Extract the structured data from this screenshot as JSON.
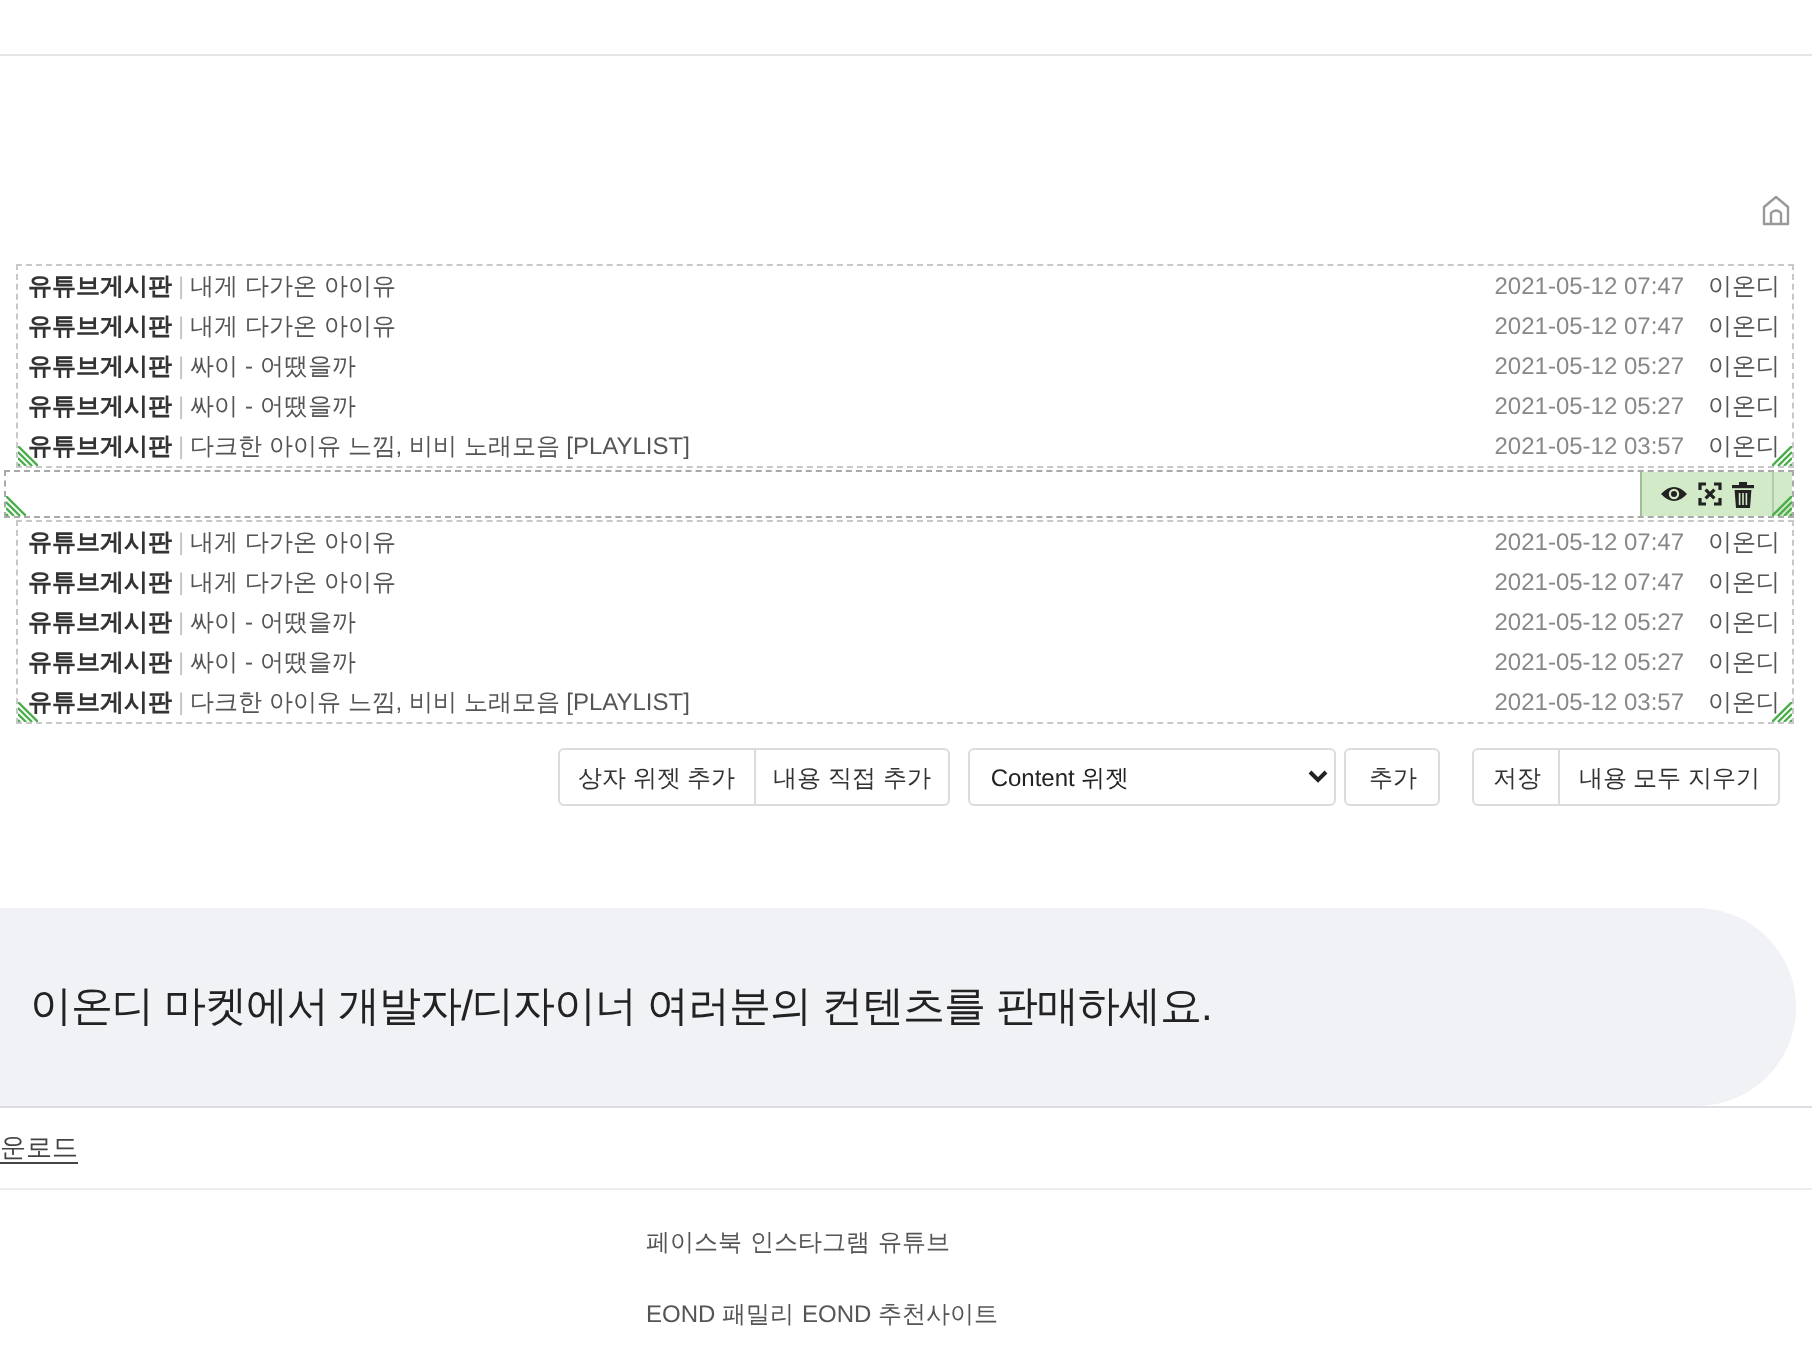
{
  "widgets": [
    {
      "kind": "post_list",
      "selected": false,
      "rows": [
        {
          "board": "유튜브게시판",
          "separator": "|",
          "title": "내게 다가온 아이유",
          "date": "2021-05-12 07:47",
          "author": "이온디"
        },
        {
          "board": "유튜브게시판",
          "separator": "|",
          "title": "내게 다가온 아이유",
          "date": "2021-05-12 07:47",
          "author": "이온디"
        },
        {
          "board": "유튜브게시판",
          "separator": "|",
          "title": "싸이 - 어땠을까",
          "date": "2021-05-12 05:27",
          "author": "이온디"
        },
        {
          "board": "유튜브게시판",
          "separator": "|",
          "title": "싸이 - 어땠을까",
          "date": "2021-05-12 05:27",
          "author": "이온디"
        },
        {
          "board": "유튜브게시판",
          "separator": "|",
          "title": "다크한 아이유 느낌, 비비 노래모음 [PLAYLIST]",
          "date": "2021-05-12 03:57",
          "author": "이온디"
        }
      ]
    },
    {
      "kind": "empty",
      "selected": true
    },
    {
      "kind": "post_list",
      "selected": false,
      "rows": [
        {
          "board": "유튜브게시판",
          "separator": "|",
          "title": "내게 다가온 아이유",
          "date": "2021-05-12 07:47",
          "author": "이온디"
        },
        {
          "board": "유튜브게시판",
          "separator": "|",
          "title": "내게 다가온 아이유",
          "date": "2021-05-12 07:47",
          "author": "이온디"
        },
        {
          "board": "유튜브게시판",
          "separator": "|",
          "title": "싸이 - 어땠을까",
          "date": "2021-05-12 05:27",
          "author": "이온디"
        },
        {
          "board": "유튜브게시판",
          "separator": "|",
          "title": "싸이 - 어땠을까",
          "date": "2021-05-12 05:27",
          "author": "이온디"
        },
        {
          "board": "유튜브게시판",
          "separator": "|",
          "title": "다크한 아이유 느낌, 비비 노래모음 [PLAYLIST]",
          "date": "2021-05-12 03:57",
          "author": "이온디"
        }
      ]
    }
  ],
  "controls": [
    {
      "kind": "group",
      "buttons": [
        "상자 위젯 추가",
        "내용 직접 추가"
      ]
    },
    {
      "kind": "select",
      "value": "Content 위젯"
    },
    {
      "kind": "button",
      "label": "추가"
    },
    {
      "kind": "group",
      "buttons": [
        "저장",
        "내용 모두 지우기"
      ]
    }
  ],
  "banner": {
    "text": "이온디 마켓에서 개발자/디자이너 여러분의 컨텐츠를 판매하세요."
  },
  "menu_link": "운로드",
  "footer": {
    "social_links": [
      "페이스북",
      "인스타그램",
      "유튜브"
    ],
    "site_links": [
      "EOND 패밀리",
      "EOND 추천사이트"
    ]
  }
}
